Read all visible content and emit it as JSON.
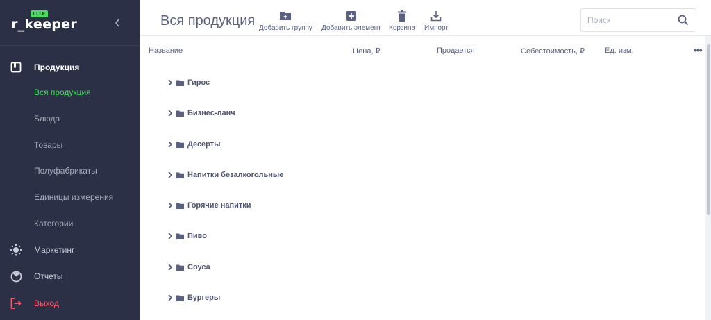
{
  "sidebar": {
    "logo": {
      "text": "r_keeper",
      "badge": "LITE"
    },
    "collapse_icon": "chevron-left-icon",
    "items": [
      {
        "label": "Продукция",
        "icon": "book-icon"
      },
      {
        "label": "Вся продукция"
      },
      {
        "label": "Блюда"
      },
      {
        "label": "Товары"
      },
      {
        "label": "Полуфабрикаты"
      },
      {
        "label": "Единицы измерения"
      },
      {
        "label": "Категории"
      },
      {
        "label": "Маркетинг",
        "icon": "sun-icon"
      },
      {
        "label": "Отчеты",
        "icon": "chart-icon"
      },
      {
        "label": "Выход",
        "icon": "logout-icon"
      }
    ]
  },
  "header": {
    "title": "Вся продукция",
    "toolbar": {
      "add_group": "Добавить группу",
      "add_item": "Добавить элемент",
      "trash": "Корзина",
      "import": "Импорт"
    },
    "search": {
      "placeholder": "Поиск",
      "value": ""
    }
  },
  "table": {
    "columns": [
      "Название",
      "Цена, ₽",
      "Продается",
      "Себестоимость, ₽",
      "Ед. изм."
    ],
    "more_icon": "•••",
    "rows": [
      "Гирос",
      "Бизнес-ланч",
      "Десерты",
      "Напитки безалкогольные",
      "Горячие напитки",
      "Пиво",
      "Соуса",
      "Бургеры"
    ]
  },
  "colors": {
    "sidebar_bg": "#2b3046",
    "accent_green": "#4cd964",
    "exit_red": "#ff5a6a",
    "text_primary": "#5a6080"
  }
}
